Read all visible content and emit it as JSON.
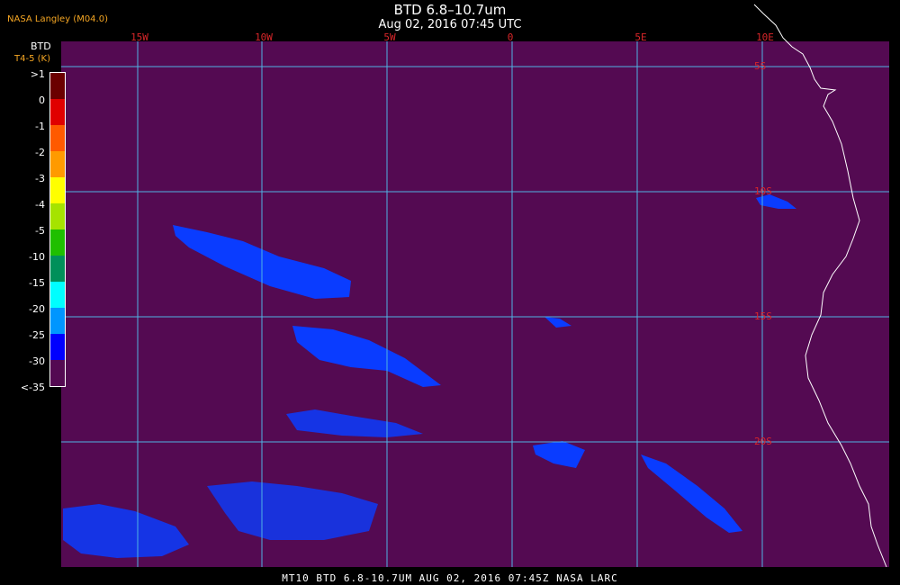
{
  "header": {
    "credit": "NASA Langley (M04.0)",
    "title": "BTD 6.8–10.7um",
    "subtitle": "Aug 02, 2016 07:45 UTC"
  },
  "colorbar": {
    "title": "BTD",
    "subtitle": "T4-5 (K)",
    "labels": [
      ">1",
      "0",
      "-1",
      "-2",
      "-3",
      "-4",
      "-5",
      "-10",
      "-15",
      "-20",
      "-25",
      "-30",
      "<-35"
    ],
    "colors": [
      "#6b0000",
      "#e00000",
      "#ff5a00",
      "#ff9a00",
      "#ffff00",
      "#a6e300",
      "#1fbf00",
      "#00905a",
      "#00ffff",
      "#0096ff",
      "#0000ff",
      "#540a52"
    ]
  },
  "map": {
    "background": "#540a52",
    "grid_color": "#4fb3e3",
    "feature_color": "#0a3cff",
    "longitudes": [
      "15W",
      "10W",
      "5W",
      "0",
      "5E",
      "10E"
    ],
    "latitudes": [
      "5S",
      "10S",
      "15S",
      "20S"
    ]
  },
  "footer": {
    "text": "MT10  BTD 6.8-10.7UM  AUG 02, 2016 07:45Z  NASA LARC"
  }
}
